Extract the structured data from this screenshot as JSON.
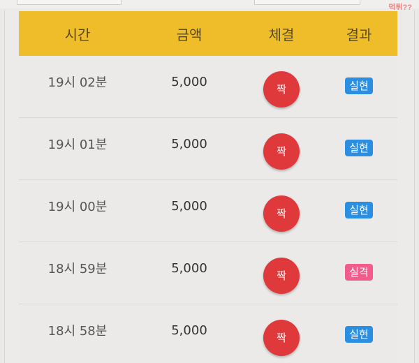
{
  "watermark": "먹튀??",
  "header": {
    "time": "시간",
    "amount": "금액",
    "exec": "체결",
    "result": "결과"
  },
  "rows": [
    {
      "time": "19시 02분",
      "amount": "5,000",
      "exec": "짝",
      "result": "실현"
    },
    {
      "time": "19시 01분",
      "amount": "5,000",
      "exec": "짝",
      "result": "실현"
    },
    {
      "time": "19시 00분",
      "amount": "5,000",
      "exec": "짝",
      "result": "실현"
    },
    {
      "time": "18시 59분",
      "amount": "5,000",
      "exec": "짝",
      "result": "실격"
    },
    {
      "time": "18시 58분",
      "amount": "5,000",
      "exec": "짝",
      "result": "실현"
    }
  ],
  "colors": {
    "header_bg": "#f0bd2a",
    "exec_circle": "#e0393b",
    "badge_success": "#2b8ee0",
    "badge_fail": "#f05d8c"
  }
}
